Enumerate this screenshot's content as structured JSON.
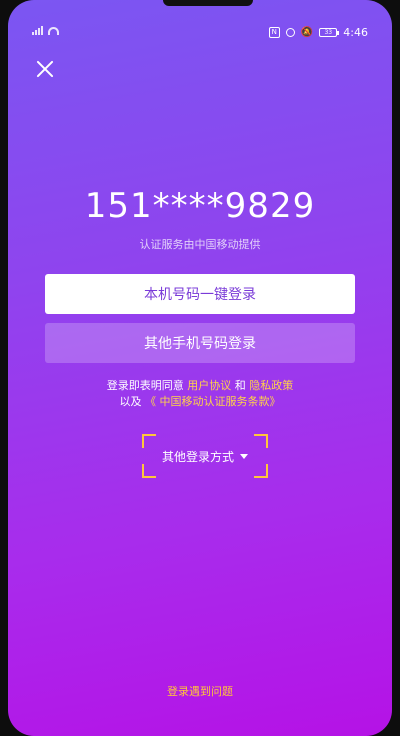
{
  "status_bar": {
    "left_icons": [
      "signal-icon",
      "wifi-icon"
    ],
    "right_icons": [
      "nfc-icon",
      "alarm-icon",
      "mute-icon",
      "battery-icon"
    ],
    "nfc_label": "N",
    "battery_label": "33",
    "time": "4:46"
  },
  "login": {
    "phone_number": "151****9829",
    "provider_note": "认证服务由中国移动提供",
    "one_click_label": "本机号码一键登录",
    "other_phone_label": "其他手机号码登录",
    "agreement": {
      "prefix": "登录即表明同意 ",
      "user_agreement": "用户协议",
      "and": " 和 ",
      "privacy_policy": "隐私政策",
      "line2_prefix": "以及 ",
      "cmcc_terms": "《 中国移动认证服务条款》"
    },
    "other_methods_label": "其他登录方式",
    "help_label": "登录遇到问题"
  },
  "colors": {
    "gradient_top": "#7b56f2",
    "gradient_bottom": "#b512e6",
    "accent_yellow": "#ffc63a",
    "primary_text": "#7a3bd8"
  }
}
